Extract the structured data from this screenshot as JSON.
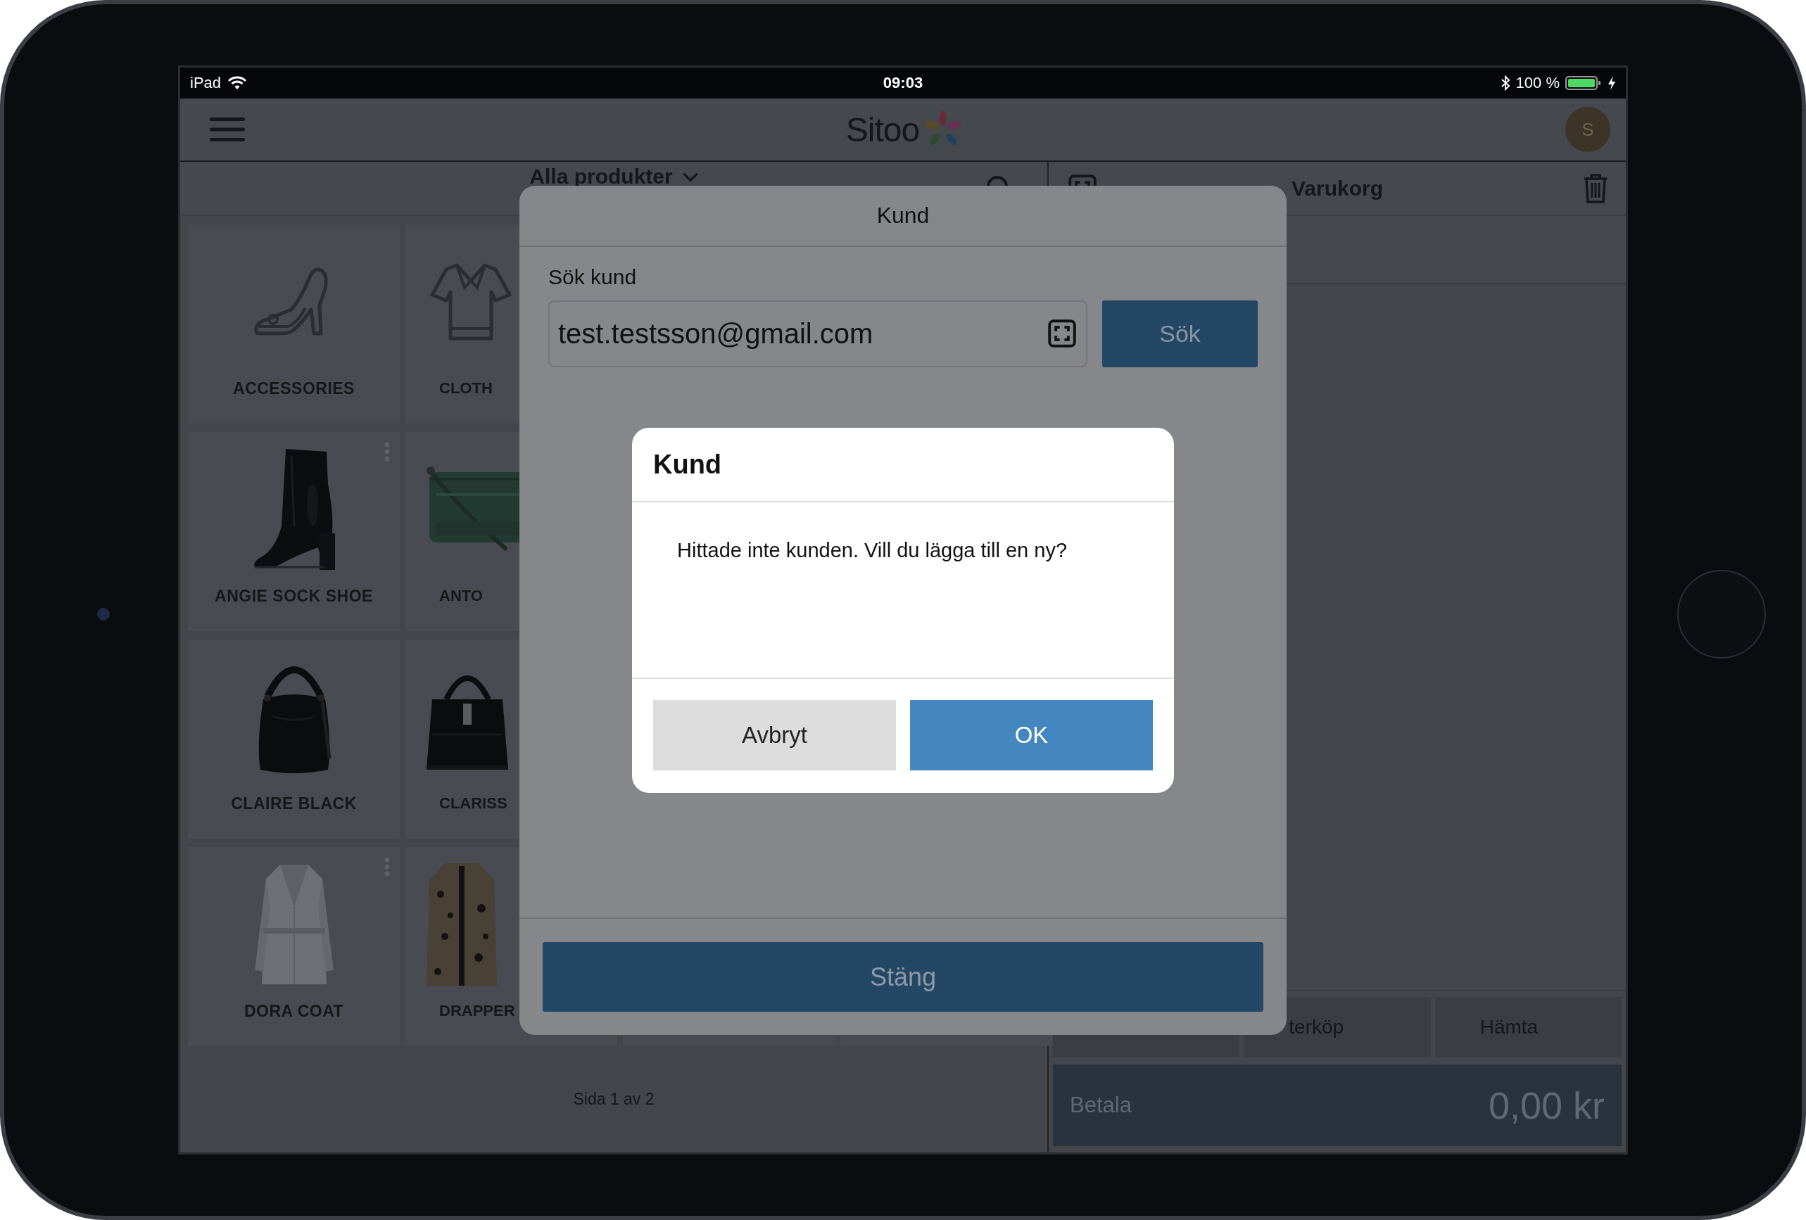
{
  "status_bar": {
    "device": "iPad",
    "time": "09:03",
    "battery": "100 %"
  },
  "header": {
    "logo": "Sitoo",
    "avatar": "S"
  },
  "products": {
    "title": "Alla produkter",
    "tiles": [
      {
        "label": "ACCESSORIES",
        "kind": "category",
        "menu": false
      },
      {
        "label": "CLOTH",
        "kind": "category",
        "menu": false
      },
      {
        "label": "ANGIE SOCK SHOE",
        "kind": "picture",
        "menu": true
      },
      {
        "label": "ANTO",
        "kind": "picture",
        "menu": false
      },
      {
        "label": "CLAIRE BLACK",
        "kind": "picture",
        "menu": false
      },
      {
        "label": "CLARISS",
        "kind": "picture",
        "menu": false
      },
      {
        "label": "DORA COAT",
        "kind": "picture",
        "menu": true
      },
      {
        "label": "DRAPPER",
        "kind": "picture",
        "menu": false
      }
    ],
    "pagination": "Sida 1 av 2"
  },
  "cart": {
    "title": "Varukorg",
    "actions": [
      {
        "label": "terköp"
      },
      {
        "label": "Hämta"
      }
    ],
    "pay": {
      "label": "Betala",
      "amount": "0,00 kr"
    }
  },
  "customer_modal": {
    "title": "Kund",
    "search_label": "Sök kund",
    "search_value": "test.testsson@gmail.com",
    "search_button": "Sök",
    "close_button": "Stäng"
  },
  "alert": {
    "title": "Kund",
    "message": "Hittade inte kunden. Vill du lägga till en ny?",
    "buttons": [
      {
        "label": "Avbryt",
        "kind": "secondary"
      },
      {
        "label": "OK",
        "kind": "primary"
      }
    ]
  }
}
